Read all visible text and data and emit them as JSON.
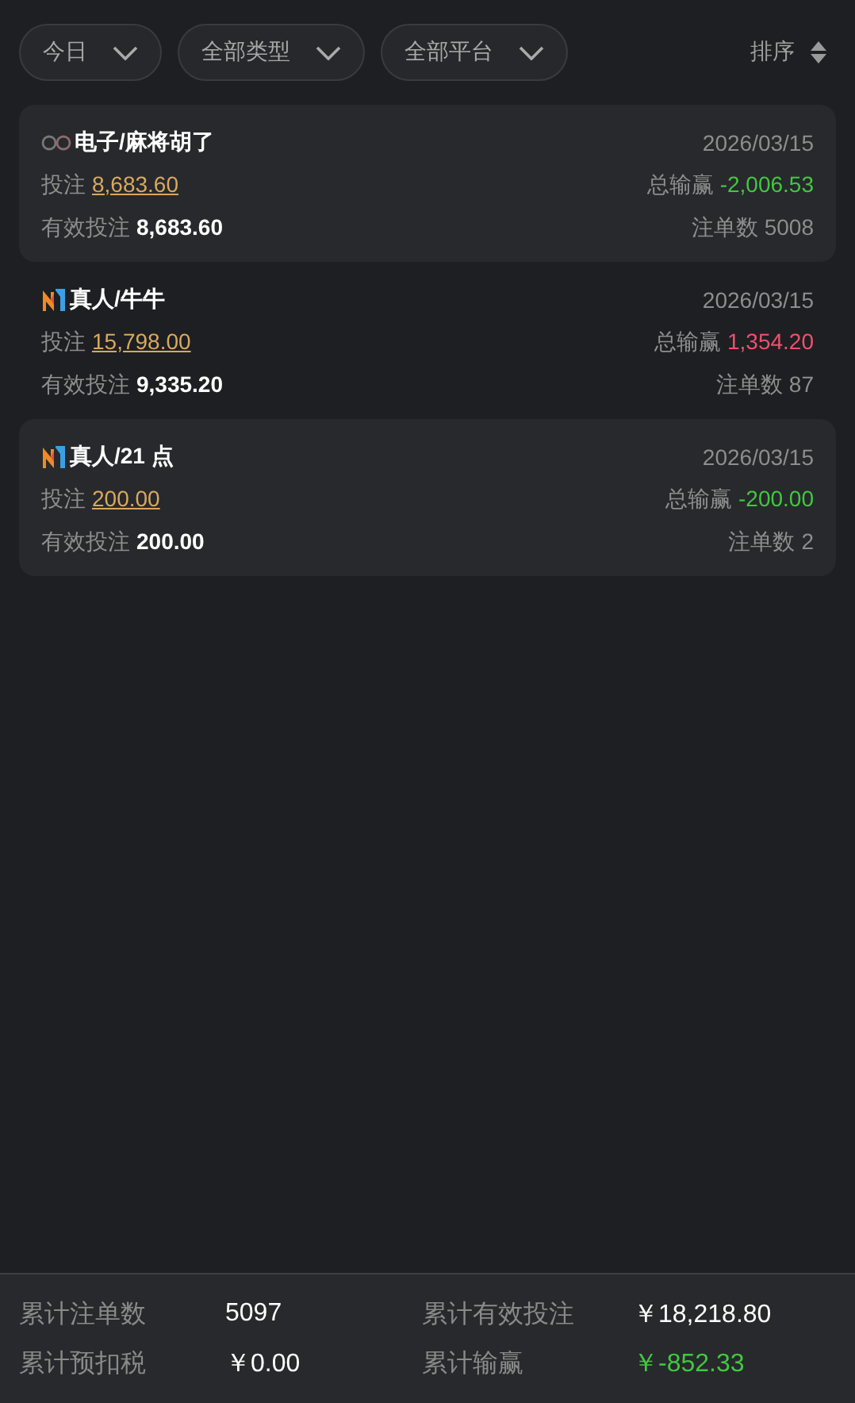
{
  "filters": [
    {
      "label": "今日"
    },
    {
      "label": "全部类型"
    },
    {
      "label": "全部平台"
    }
  ],
  "sort": {
    "label": "排序"
  },
  "records": [
    {
      "kind": "electronic",
      "title": "电子/麻将胡了",
      "date": "2026/03/15",
      "bet_label": "投注",
      "bet": "8,683.60",
      "win_label": "总输赢",
      "win": "-2,006.53",
      "color": "#3fc93f",
      "valid_label": "有效投注",
      "valid": "8,683.60",
      "count_label": "注单数",
      "count": "5008"
    },
    {
      "kind": "live",
      "title": "真人/牛牛",
      "date": "2026/03/15",
      "bet_label": "投注",
      "bet": "15,798.00",
      "win_label": "总输赢",
      "win": "1,354.20",
      "color": "#f0506e",
      "valid_label": "有效投注",
      "valid": "9,335.20",
      "count_label": "注单数",
      "count": "87"
    },
    {
      "kind": "live",
      "title": "真人/21 点",
      "date": "2026/03/15",
      "bet_label": "投注",
      "bet": "200.00",
      "win_label": "总输赢",
      "win": "-200.00",
      "color": "#3fc93f",
      "valid_label": "有效投注",
      "valid": "200.00",
      "count_label": "注单数",
      "count": "2"
    }
  ],
  "summary": [
    {
      "label": "累计注单数",
      "value": "5097",
      "color": "#ffffff"
    },
    {
      "label": "累计有效投注",
      "value": "￥18,218.80",
      "color": "#ffffff"
    },
    {
      "label": "累计预扣税",
      "value": "￥0.00",
      "color": "#ffffff"
    },
    {
      "label": "累计输赢",
      "value": "￥-852.33",
      "color": "#3fc93f"
    }
  ]
}
